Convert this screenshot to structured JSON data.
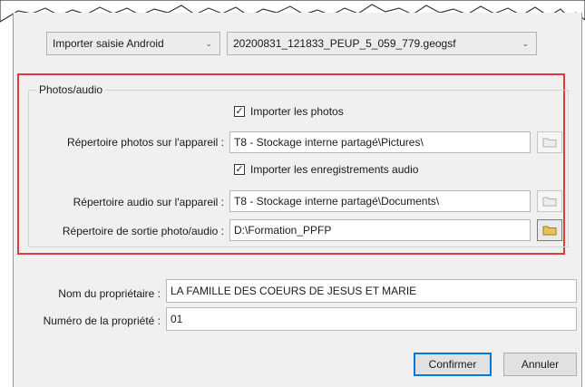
{
  "top": {
    "import_source": "Importer saisie Android",
    "file": "20200831_121833_PEUP_5_059_779.geogsf"
  },
  "media_group": {
    "title": "Photos/audio",
    "import_photos": {
      "label": "Importer les photos",
      "checked": true
    },
    "photos_dir": {
      "label": "Répertoire photos sur l'appareil :",
      "value": "T8 - Stockage interne partagé\\Pictures\\"
    },
    "import_audio": {
      "label": "Importer les enregistrements audio",
      "checked": true
    },
    "audio_dir": {
      "label": "Répertoire audio sur l'appareil :",
      "value": "T8 - Stockage interne partagé\\Documents\\"
    },
    "output_dir": {
      "label": "Répertoire de sortie photo/audio :",
      "value": "D:\\Formation_PPFP"
    }
  },
  "owner": {
    "label": "Nom du propriétaire :",
    "value": "LA FAMILLE DES COEURS DE JESUS ET MARIE"
  },
  "property": {
    "label": "Numéro de la propriété :",
    "value": "01"
  },
  "buttons": {
    "confirm": "Confirmer",
    "cancel": "Annuler"
  },
  "icons": {
    "browse": "folder-icon",
    "dropdown": "chevron-down-icon",
    "check": "checkmark-icon"
  },
  "colors": {
    "highlight": "#e0393e",
    "accent": "#0078d7",
    "folder_enabled": "#e8c25a"
  }
}
